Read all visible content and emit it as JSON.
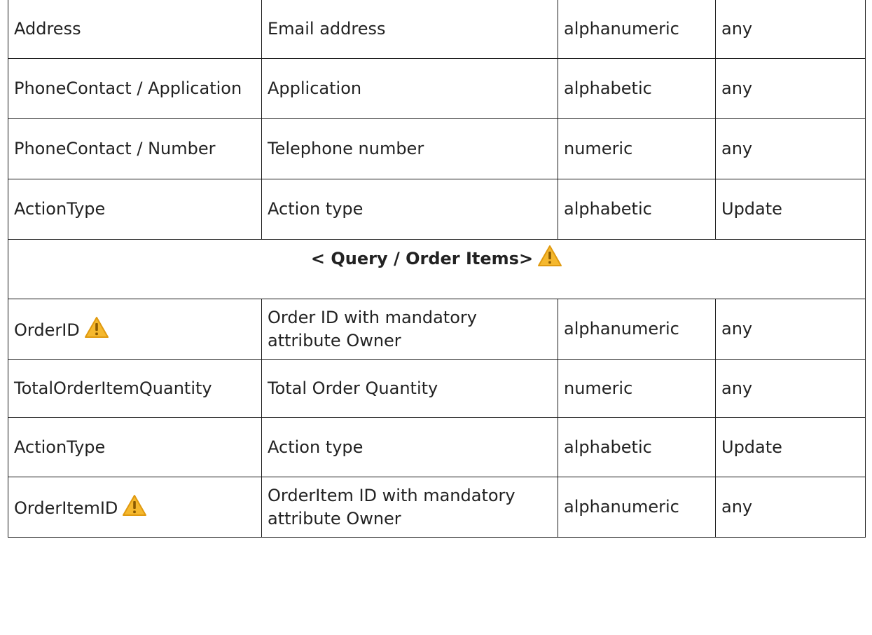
{
  "colors": {
    "border": "#1a1a1a",
    "text": "#222222",
    "warning_fill": "#f5b82e",
    "warning_mark": "#8a5a00"
  },
  "icons": {
    "warning": "warning-icon"
  },
  "rows": [
    {
      "field": "Address",
      "description": "Email address",
      "type": "alphanumeric",
      "value": "any"
    },
    {
      "field": "PhoneContact / Application",
      "description": "Application",
      "type": "alphabetic",
      "value": "any"
    },
    {
      "field": "PhoneContact / Number",
      "description": "Telephone number",
      "type": "numeric",
      "value": "any"
    },
    {
      "field": "ActionType",
      "description": "Action type",
      "type": "alphabetic",
      "value": "Update"
    }
  ],
  "section": {
    "title": "< Query / Order Items>"
  },
  "rows2": [
    {
      "field": "OrderID",
      "description": "Order ID with mandatory attribute Owner",
      "type": "alphanumeric",
      "value": "any"
    },
    {
      "field": "TotalOrderItemQuantity",
      "description": "Total Order Quantity",
      "type": "numeric",
      "value": "any"
    },
    {
      "field": "ActionType",
      "description": "Action type",
      "type": "alphabetic",
      "value": "Update"
    },
    {
      "field": "OrderItemID",
      "description": "OrderItem ID with mandatory attribute Owner",
      "type": "alphanumeric",
      "value": "any"
    }
  ]
}
